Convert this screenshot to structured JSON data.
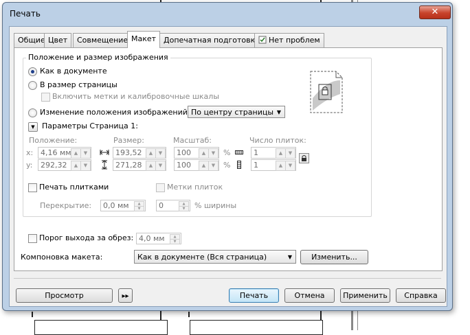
{
  "dialog": {
    "title": "Печать",
    "close_icon": "close-icon"
  },
  "tabs": [
    {
      "label": "Общие",
      "active": false
    },
    {
      "label": "Цвет",
      "active": false
    },
    {
      "label": "Совмещение",
      "active": false
    },
    {
      "label": "Макет",
      "active": true
    },
    {
      "label": "Допечатная подготовка",
      "active": false
    },
    {
      "label": "Нет проблем",
      "active": false,
      "icon": "checklist-icon"
    }
  ],
  "layout": {
    "group_title": "Положение и размер изображения",
    "radio_as_document": "Как в документе",
    "radio_fit_page": "В размер страницы",
    "check_marks": "Включить метки и калибровочные шкалы",
    "radio_reposition": "Изменение положения изображений на:",
    "reposition_combo": "По центру страницы",
    "params_label": "Параметры Страница 1:",
    "col_position": "Положение:",
    "col_size": "Размер:",
    "col_scale": "Масштаб:",
    "col_tiles": "Число плиток:",
    "x_label": "x:",
    "y_label": "y:",
    "pos_x": "4,16 мм",
    "pos_y": "292,32",
    "size_w": "193,52",
    "size_h": "271,28",
    "scale_x": "100",
    "scale_y": "100",
    "percent": "%",
    "tiles_x": "1",
    "tiles_y": "1",
    "print_tiles": "Печать плитками",
    "tile_marks": "Метки плиток",
    "overlap_label": "Перекрытие:",
    "overlap_value": "0,0 мм",
    "overlap_pct": "0",
    "width_pct_label": "% ширины",
    "bleed_label": "Порог выхода за обрез:",
    "bleed_value": "4,0 мм",
    "imposition_label": "Компоновка макета:",
    "imposition_combo": "Как в документе (Вся страница)",
    "edit_button": "Изменить..."
  },
  "footer": {
    "preview": "Просмотр",
    "print": "Печать",
    "cancel": "Отмена",
    "apply": "Применить",
    "help": "Справка"
  }
}
